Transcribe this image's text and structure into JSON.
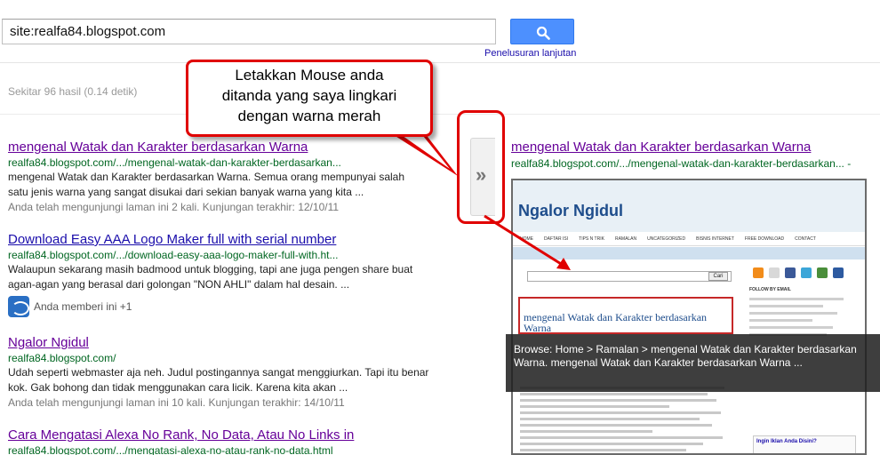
{
  "search": {
    "query": "site:realfa84.blogspot.com",
    "advanced_link": "Penelusuran lanjutan"
  },
  "stats": "Sekitar 96 hasil (0.14 detik)",
  "callout": {
    "lines": [
      "Letakkan Mouse anda",
      "ditanda yang saya lingkari",
      "dengan warna merah"
    ]
  },
  "results": [
    {
      "title": "mengenal Watak dan Karakter berdasarkan Warna",
      "url": "realfa84.blogspot.com/.../mengenal-watak-dan-karakter-berdasarkan...",
      "snippet": [
        "mengenal Watak dan Karakter berdasarkan Warna. Semua orang mempunyai salah",
        "satu jenis warna yang sangat disukai dari sekian banyak warna yang kita ..."
      ],
      "visited": "Anda telah mengunjungi laman ini 2 kali. Kunjungan terakhir: 12/10/11"
    },
    {
      "title": "Download Easy AAA Logo Maker full with serial number",
      "url": "realfa84.blogspot.com/.../download-easy-aaa-logo-maker-full-with.ht...",
      "snippet": [
        "Walaupun sekarang masih badmood untuk blogging, tapi ane juga pengen share buat",
        "agan-agan yang berasal dari golongan \"NON AHLI\" dalam hal desain. ..."
      ],
      "plus_one": "Anda memberi ini +1"
    },
    {
      "title": "Ngalor Ngidul",
      "url": "realfa84.blogspot.com/",
      "snippet": [
        "Udah seperti webmaster aja neh. Judul postingannya sangat menggiurkan. Tapi itu benar",
        "kok. Gak bohong dan tidak menggunakan cara licik. Karena kita akan ..."
      ],
      "visited": "Anda telah mengunjungi laman ini 10 kali. Kunjungan terakhir: 14/10/11"
    },
    {
      "title": "Cara Mengatasi Alexa No Rank, No Data, Atau No Links in",
      "url": "realfa84.blogspot.com/.../mengatasi-alexa-no-atau-rank-no-data.html"
    }
  ],
  "preview": {
    "toggle_glyph": "»",
    "title": "mengenal Watak dan Karakter berdasarkan Warna",
    "url": "realfa84.blogspot.com/.../mengenal-watak-dan-karakter-berdasarkan... -",
    "site_name": "Ngalor Ngidul",
    "nav": [
      "HOME",
      "DAFTAR ISI",
      "TIPS N TRIK",
      "RAMALAN",
      "UNCATEGORIZED",
      "BISNIS INTERNET",
      "FREE DOWNLOAD",
      "CONTACT"
    ],
    "search_button": "Cari",
    "follow_label": "FOLLOW BY EMAIL",
    "post_title": "mengenal Watak dan Karakter berdasarkan Warna",
    "ad_text": "Ingin Iklan Anda Disini?",
    "tooltip": "Browse: Home > Ramalan > mengenal Watak dan Karakter berdasarkan Warna. mengenal Watak dan Karakter berdasarkan Warna ..."
  },
  "colors": {
    "annotation_red": "#e00000",
    "link_visited": "#660099",
    "link": "#1a0dab",
    "url_green": "#006621",
    "search_blue": "#4d90fe"
  }
}
